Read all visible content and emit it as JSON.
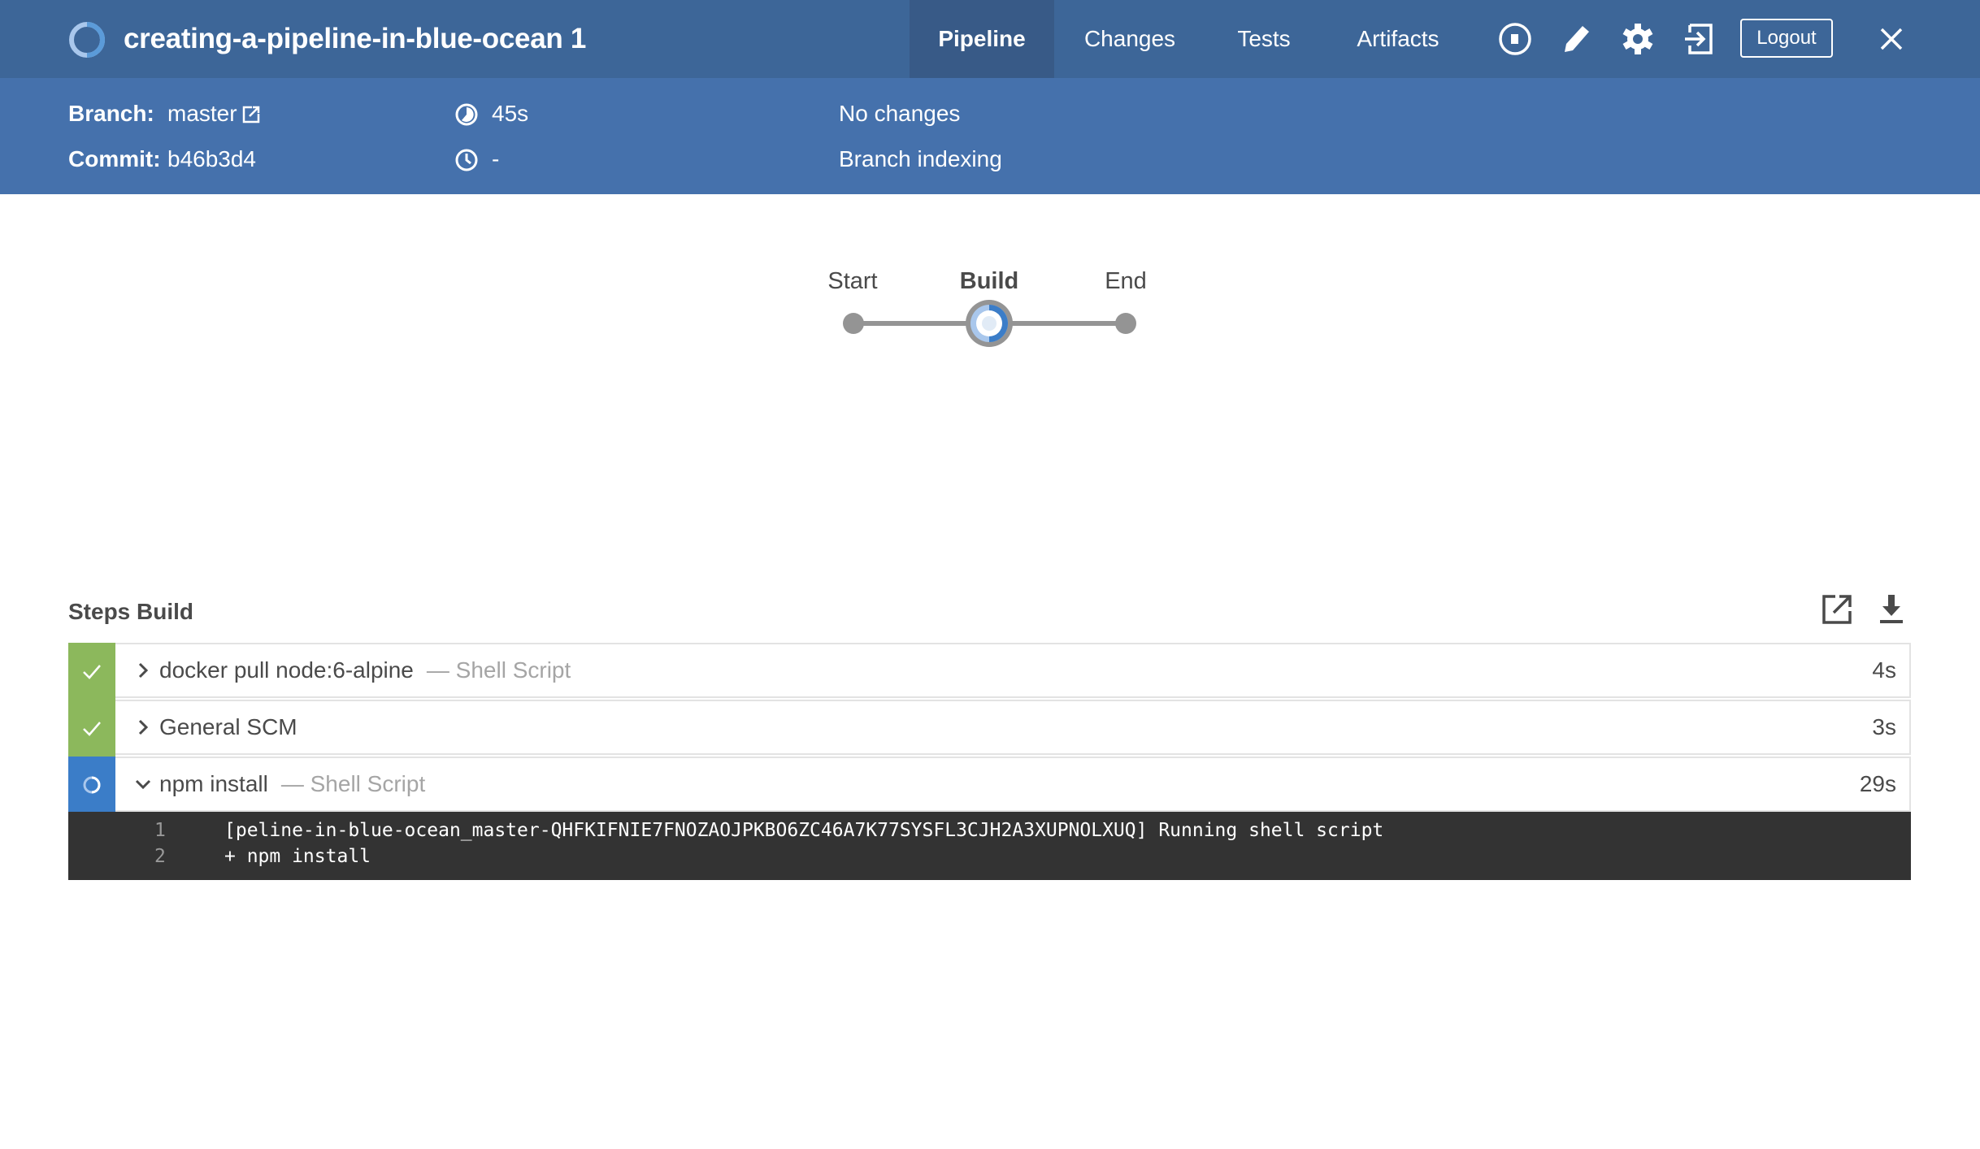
{
  "header": {
    "title": "creating-a-pipeline-in-blue-ocean 1",
    "tabs": [
      {
        "label": "Pipeline",
        "active": true
      },
      {
        "label": "Changes",
        "active": false
      },
      {
        "label": "Tests",
        "active": false
      },
      {
        "label": "Artifacts",
        "active": false
      }
    ],
    "icons": [
      "stop-icon",
      "pencil-icon",
      "gear-icon",
      "exit-icon"
    ],
    "logout_label": "Logout",
    "close_icon": "close-icon"
  },
  "info": {
    "branch_label": "Branch:",
    "branch_value": "master",
    "commit_label": "Commit:",
    "commit_value": "b46b3d4",
    "duration": "45s",
    "started": "-",
    "changes": "No changes",
    "cause": "Branch indexing"
  },
  "graph": {
    "nodes": [
      {
        "label": "Start",
        "state": "not-built"
      },
      {
        "label": "Build",
        "state": "running",
        "selected": true
      },
      {
        "label": "End",
        "state": "not-built"
      }
    ]
  },
  "steps": {
    "title": "Steps Build",
    "items": [
      {
        "name": "docker pull node:6-alpine",
        "type": "— Shell Script",
        "duration": "4s",
        "status": "success",
        "expanded": false
      },
      {
        "name": "General SCM",
        "type": "",
        "duration": "3s",
        "status": "success",
        "expanded": false
      },
      {
        "name": "npm install",
        "type": "— Shell Script",
        "duration": "29s",
        "status": "running",
        "expanded": true
      }
    ],
    "log": [
      {
        "n": "1",
        "text": "[peline-in-blue-ocean_master-QHFKIFNIE7FNOZAOJPKBO6ZC46A7K77SYSFL3CJH2A3XUPNOLXUQ] Running shell script"
      },
      {
        "n": "2",
        "text": "+ npm install"
      }
    ]
  },
  "colors": {
    "header": "#3d6698",
    "infobar": "#4571ac",
    "success": "#8cb85c",
    "running": "#3b7dc8",
    "log_bg": "#333333"
  }
}
